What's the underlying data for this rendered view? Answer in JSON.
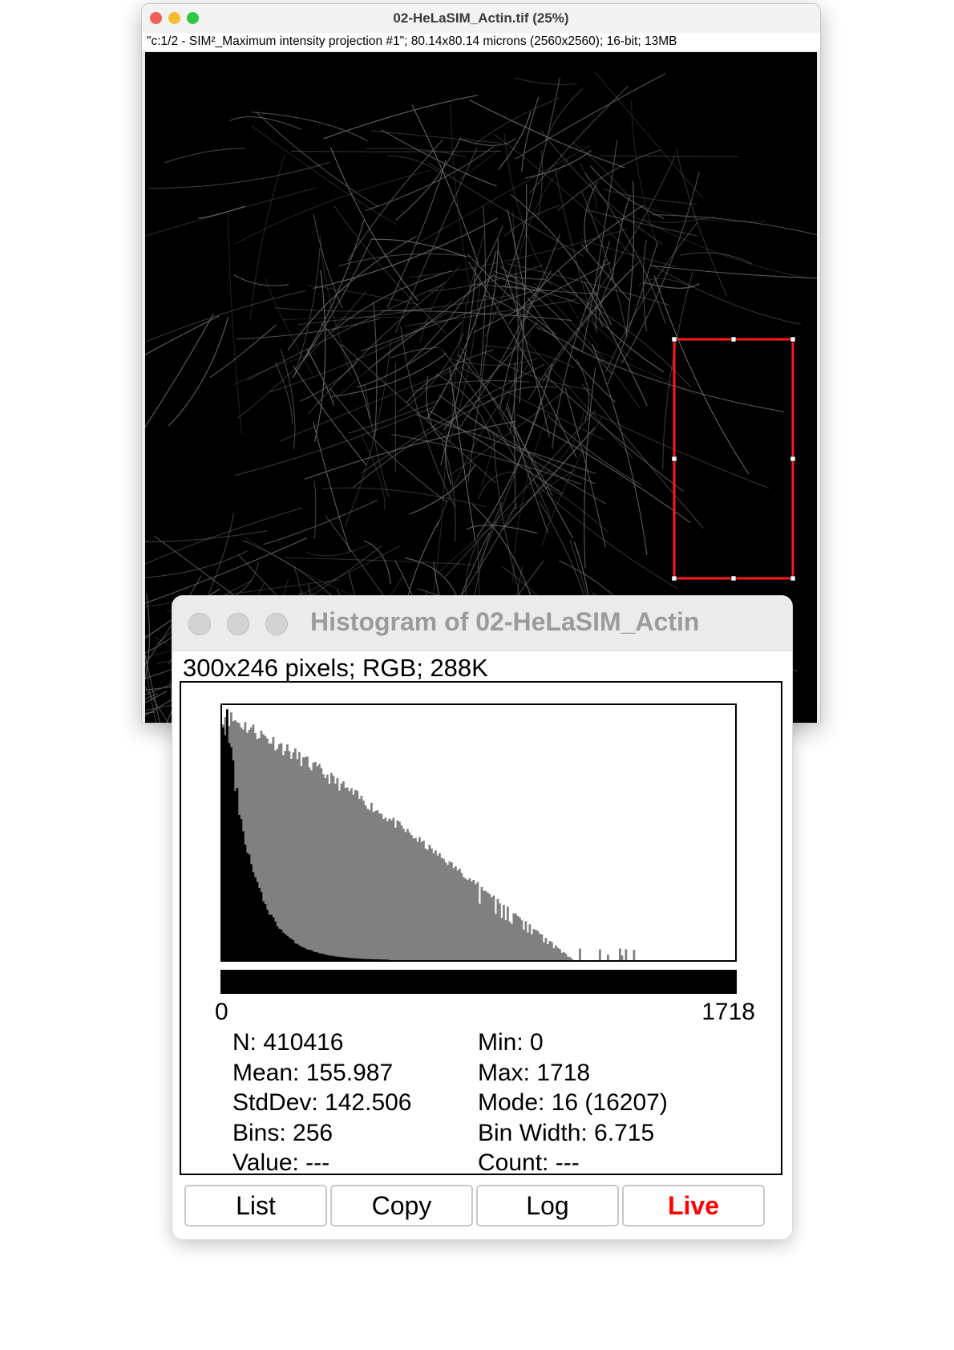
{
  "image_window": {
    "title": "02-HeLaSIM_Actin.tif (25%)",
    "subtitle": "\"c:1/2 - SIM²_Maximum intensity projection #1\"; 80.14x80.14 microns (2560x2560); 16-bit; 13MB",
    "roi_color": "#ff0000"
  },
  "histogram_window": {
    "title": "Histogram of 02-HeLaSIM_Actin",
    "subtitle": "300x246 pixels; RGB; 288K",
    "axis_min": "0",
    "axis_max": "1718",
    "stats": {
      "n": "N: 410416",
      "mean": "Mean: 155.987",
      "stddev": "StdDev: 142.506",
      "bins": "Bins: 256",
      "value": "Value: ---",
      "min": "Min: 0",
      "max": "Max: 1718",
      "mode": "Mode: 16 (16207)",
      "bin_width": "Bin Width: 6.715",
      "count": "Count: ---"
    },
    "buttons": {
      "list": "List",
      "copy": "Copy",
      "log": "Log",
      "live": "Live"
    },
    "live_color": "#ff0000"
  },
  "chart_data": {
    "type": "bar",
    "bins": 256,
    "xlim": [
      0,
      1718
    ],
    "bin_width": 6.715,
    "series": [
      {
        "display": "linear",
        "color": "#000000",
        "decay_end_bin": 60
      },
      {
        "display": "log",
        "color": "#808080",
        "decay_end_bin": 175
      }
    ]
  }
}
